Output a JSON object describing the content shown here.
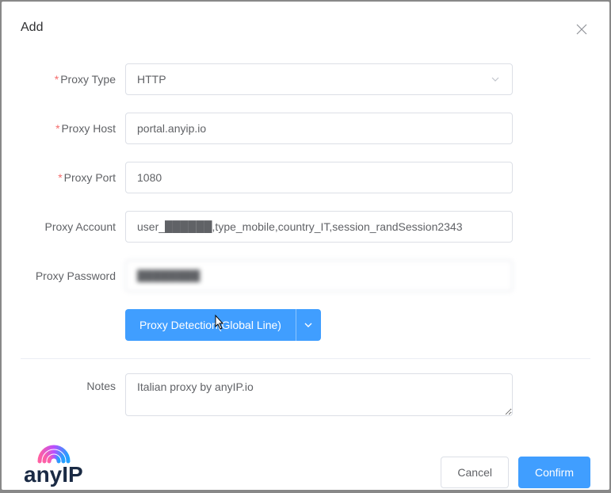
{
  "title": "Add",
  "fields": {
    "proxy_type": {
      "label": "Proxy Type",
      "value": "HTTP",
      "required": true
    },
    "proxy_host": {
      "label": "Proxy Host",
      "value": "portal.anyip.io",
      "required": true
    },
    "proxy_port": {
      "label": "Proxy Port",
      "value": "1080",
      "required": true
    },
    "proxy_account": {
      "label": "Proxy Account",
      "value": "user_██████,type_mobile,country_IT,session_randSession2343",
      "required": false
    },
    "proxy_password": {
      "label": "Proxy Password",
      "value": "████████",
      "required": false
    },
    "notes": {
      "label": "Notes",
      "value": "Italian proxy by anyIP.io",
      "required": false
    }
  },
  "detection_button": "Proxy Detection(Global Line)",
  "footer": {
    "cancel": "Cancel",
    "confirm": "Confirm"
  },
  "brand": "anyIP",
  "colors": {
    "primary": "#409eff",
    "required": "#f56c6c"
  }
}
